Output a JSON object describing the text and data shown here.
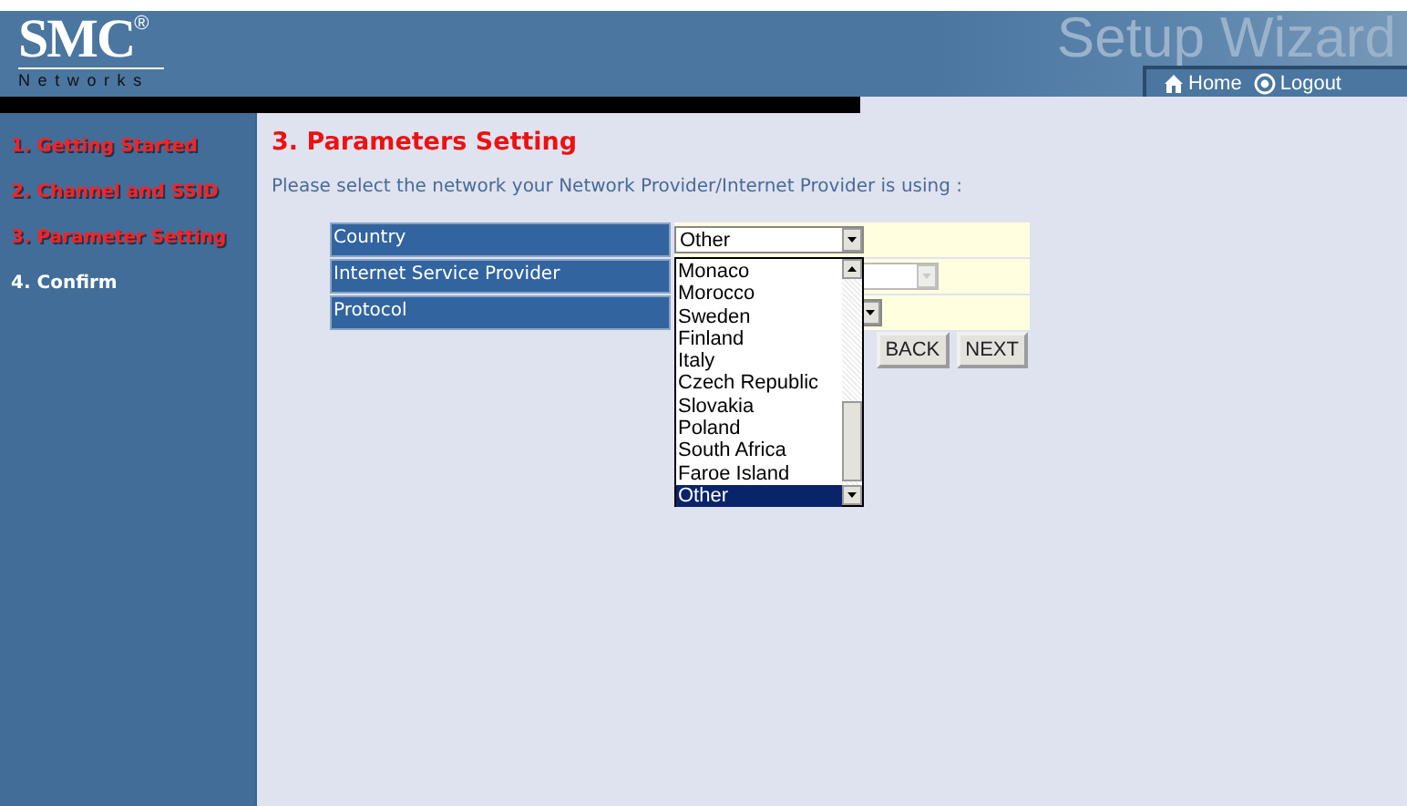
{
  "header": {
    "logo": "SMC",
    "logo_mark": "®",
    "logo_sub": "Networks",
    "banner": "Setup Wizard",
    "links": [
      {
        "label": "Home",
        "kind": "home"
      },
      {
        "label": "Logout",
        "kind": "logout"
      }
    ]
  },
  "sidebar": {
    "steps": [
      {
        "label": "1. Getting Started",
        "done": true
      },
      {
        "label": "2. Channel and SSID",
        "done": true
      },
      {
        "label": "3. Parameter Setting",
        "done": true
      },
      {
        "label": "4. Confirm",
        "done": false
      }
    ]
  },
  "title": "3. Parameters Setting",
  "instruction": "Please select the network your Network Provider/Internet Provider is using :",
  "form": {
    "fields": [
      {
        "label": "Country",
        "value": "Other",
        "disabled": false
      },
      {
        "label": "Internet Service Provider",
        "disabled": true
      },
      {
        "label": "Protocol",
        "disabled": false
      }
    ]
  },
  "dropdown": {
    "options": [
      {
        "label": "Monaco",
        "selected": false
      },
      {
        "label": "Morocco",
        "selected": false
      },
      {
        "label": "Sweden",
        "selected": false
      },
      {
        "label": "Finland",
        "selected": false
      },
      {
        "label": "Italy",
        "selected": false
      },
      {
        "label": "Czech Republic",
        "selected": false
      },
      {
        "label": "Slovakia",
        "selected": false
      },
      {
        "label": "Poland",
        "selected": false
      },
      {
        "label": "South Africa",
        "selected": false
      },
      {
        "label": "Faroe Island",
        "selected": false
      },
      {
        "label": "Other",
        "selected": true
      }
    ]
  },
  "buttons": [
    "BACK",
    "NEXT"
  ]
}
